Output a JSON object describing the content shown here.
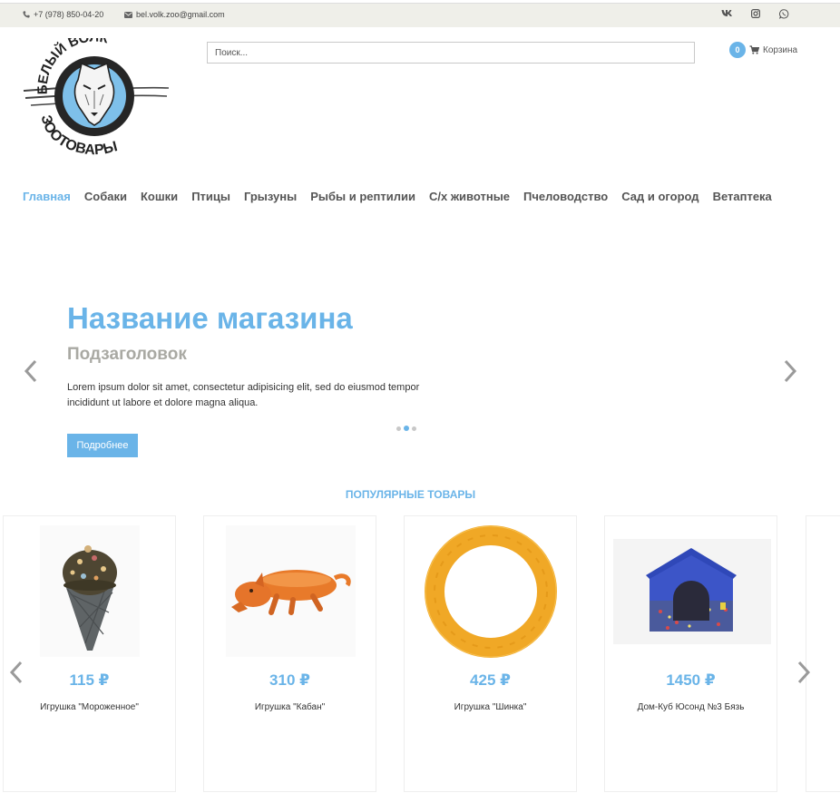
{
  "topbar": {
    "phone": "+7 (978) 850-04-20",
    "email": "bel.volk.zoo@gmail.com",
    "social": [
      "vk-icon",
      "instagram-icon",
      "whatsapp-icon"
    ],
    "vk_label": "VK"
  },
  "logo": {
    "top_text": "БЕЛЫЙ ВОЛК",
    "bottom_text": "ЗООТОВАРЫ"
  },
  "search": {
    "placeholder": "Поиск..."
  },
  "cart": {
    "count": "0",
    "label": "Корзина"
  },
  "nav": [
    "Главная",
    "Собаки",
    "Кошки",
    "Птицы",
    "Грызуны",
    "Рыбы и рептилии",
    "С/х животные",
    "Пчеловодство",
    "Сад и огород",
    "Ветаптека"
  ],
  "hero": {
    "title": "Название магазина",
    "subtitle": "Подзаголовок",
    "text": "Lorem ipsum dolor sit amet, consectetur adipisicing elit, sed do eiusmod tempor incididunt ut labore et dolore magna aliqua.",
    "button": "Подробнее"
  },
  "popular": {
    "title": "ПОПУЛЯРНЫЕ ТОВАРЫ",
    "products": [
      {
        "price": "115 ₽",
        "name": "Игрушка \"Мороженное\""
      },
      {
        "price": "310 ₽",
        "name": "Игрушка \"Кабан\""
      },
      {
        "price": "425 ₽",
        "name": "Игрушка \"Шинка\""
      },
      {
        "price": "1450 ₽",
        "name": "Дом-Куб Юсонд №3 Бязь"
      }
    ]
  },
  "colors": {
    "accent": "#6ab4e8",
    "topbar": "#efefe9",
    "subtitle": "#a9a9a3"
  }
}
